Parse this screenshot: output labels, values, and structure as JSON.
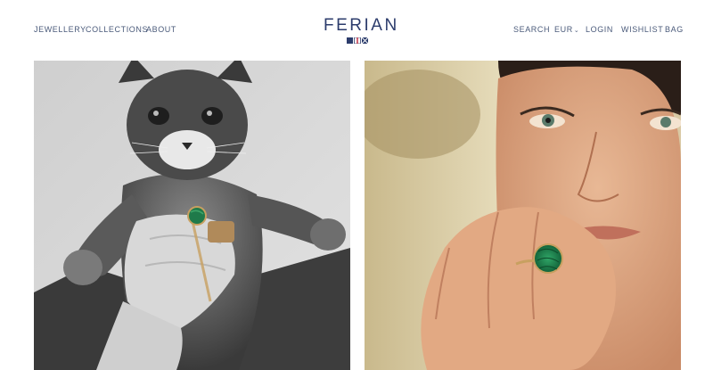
{
  "header": {
    "left_nav": [
      "JEWELLERY",
      "COLLECTIONS",
      "ABOUT"
    ],
    "brand": "FERIAN",
    "right_nav": {
      "search": "SEARCH",
      "currency": "EUR",
      "login": "LOGIN",
      "wishlist": "WISHLIST",
      "bag": "BAG"
    }
  },
  "colors": {
    "nav_text": "#4a5a7a",
    "brand": "#2c3c6c",
    "malachite": "#1f7a4a",
    "gold": "#c8a060"
  },
  "images": [
    {
      "name": "cat-photo",
      "kind": "black-and-white photo of hand holding a kitten, wearing green stone ring"
    },
    {
      "name": "woman-photo",
      "kind": "colour photo of woman with hand to face wearing malachite signet ring"
    }
  ]
}
